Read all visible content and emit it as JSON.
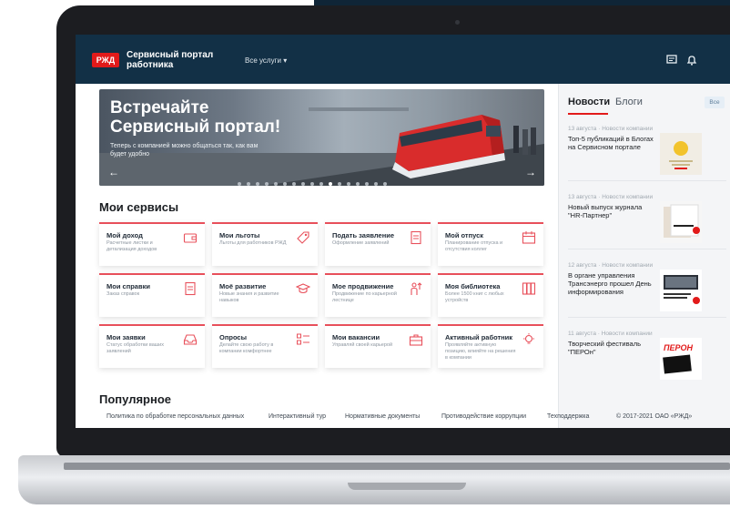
{
  "header": {
    "logo_text": "РЖД",
    "title": "Сервисный портал работника",
    "all_services": "Все услуги"
  },
  "banner": {
    "title": "Встречайте Сервисный портал!",
    "subtitle": "Теперь с компанией можно общаться так, как вам будет удобно",
    "prev": "←",
    "next": "→"
  },
  "services": {
    "heading": "Мои сервисы",
    "cards": [
      {
        "title": "Мой доход",
        "subtitle": "Расчетные листки и детализация доходов"
      },
      {
        "title": "Мои льготы",
        "subtitle": "Льготы для работников РЖД"
      },
      {
        "title": "Подать заявление",
        "subtitle": "Оформление заявлений"
      },
      {
        "title": "Мой отпуск",
        "subtitle": "Планирование отпуска и отсутствия коллег"
      },
      {
        "title": "Мои справки",
        "subtitle": "Заказ справок"
      },
      {
        "title": "Моё развитие",
        "subtitle": "Новые знания и развитие навыков"
      },
      {
        "title": "Мое продвижение",
        "subtitle": "Продвижение по карьерной лестнице"
      },
      {
        "title": "Моя библиотека",
        "subtitle": "Более 1500 книг с любых устройств"
      },
      {
        "title": "Мои заявки",
        "subtitle": "Статус обработки ваших заявлений"
      },
      {
        "title": "Опросы",
        "subtitle": "Делайте свою работу в компании комфортнее"
      },
      {
        "title": "Мои вакансии",
        "subtitle": "Управляй своей карьерой"
      },
      {
        "title": "Активный работник",
        "subtitle": "Проявляйте активную позицию, влияйте на решения в компании"
      }
    ]
  },
  "popular": {
    "heading": "Популярное"
  },
  "news": {
    "tab_news": "Новости",
    "tab_blogs": "Блоги",
    "all_button": "Все",
    "items": [
      {
        "date": "13 августа · Новости компании",
        "title": "Топ-5 публикаций в Блогах на Сервисном портале"
      },
      {
        "date": "13 августа · Новости компании",
        "title": "Новый выпуск журнала \"HR-Партнер\""
      },
      {
        "date": "12 августа · Новости компании",
        "title": "В органе управления Трансэнерго прошел День информирования"
      },
      {
        "date": "11 августа · Новости компании",
        "title": "Творческий фестиваль \"ПЕРОн\""
      }
    ],
    "thumb_labels": [
      "ПЕРОН"
    ]
  },
  "footer": {
    "links": [
      "Политика по обработке персональных данных",
      "Интерактивный тур",
      "Нормативные документы",
      "Противодействие коррупции",
      "Техподдержка"
    ],
    "copyright": "© 2017-2021 ОАО «РЖД»"
  },
  "colors": {
    "header_bg": "#123046",
    "accent": "#e21a1a",
    "card_border": "#e8505b"
  },
  "icons": [
    "chevron-down-icon",
    "chat-icon",
    "bell-icon",
    "wallet-icon",
    "tag-icon",
    "document-icon",
    "calendar-icon",
    "ruler-icon",
    "graduation-cap-icon",
    "person-growth-icon",
    "books-icon",
    "inbox-icon",
    "checklist-icon",
    "briefcase-icon",
    "lightbulb-icon"
  ]
}
